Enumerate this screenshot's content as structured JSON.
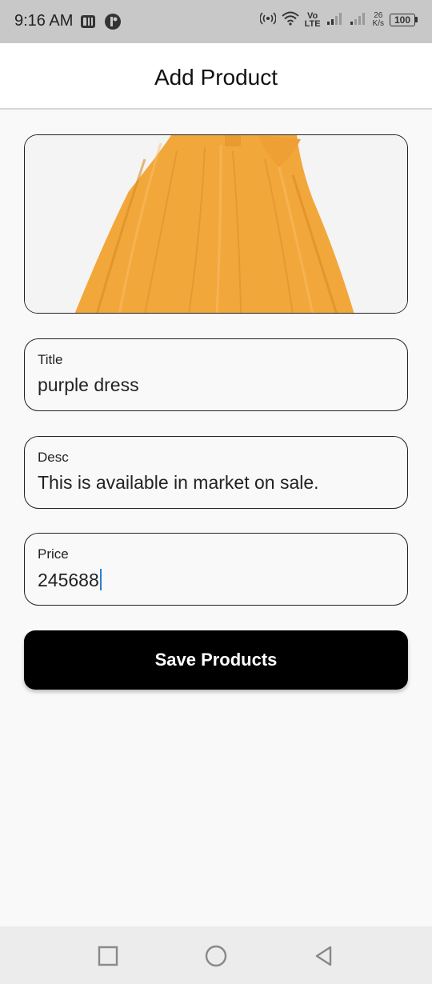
{
  "status_bar": {
    "time": "9:16 AM",
    "volte_top": "Vo",
    "volte_bottom": "LTE",
    "net_speed_value": "26",
    "net_speed_unit": "K/s",
    "battery": "100"
  },
  "app_bar": {
    "title": "Add Product"
  },
  "product_image": {
    "description_icon": "product-photo",
    "dress_color": "#f2a73b"
  },
  "form": {
    "title": {
      "label": "Title",
      "value": "purple dress"
    },
    "desc": {
      "label": "Desc",
      "value": "This is available in market on sale."
    },
    "price": {
      "label": "Price",
      "value": "245688"
    },
    "save_label": "Save Products"
  },
  "nav_bar": {
    "recents_icon": "square-icon",
    "home_icon": "circle-icon",
    "back_icon": "triangle-back-icon"
  },
  "colors": {
    "accent_caret": "#2b7fd4",
    "button_bg": "#000000",
    "page_bg": "#f9f9f9"
  }
}
